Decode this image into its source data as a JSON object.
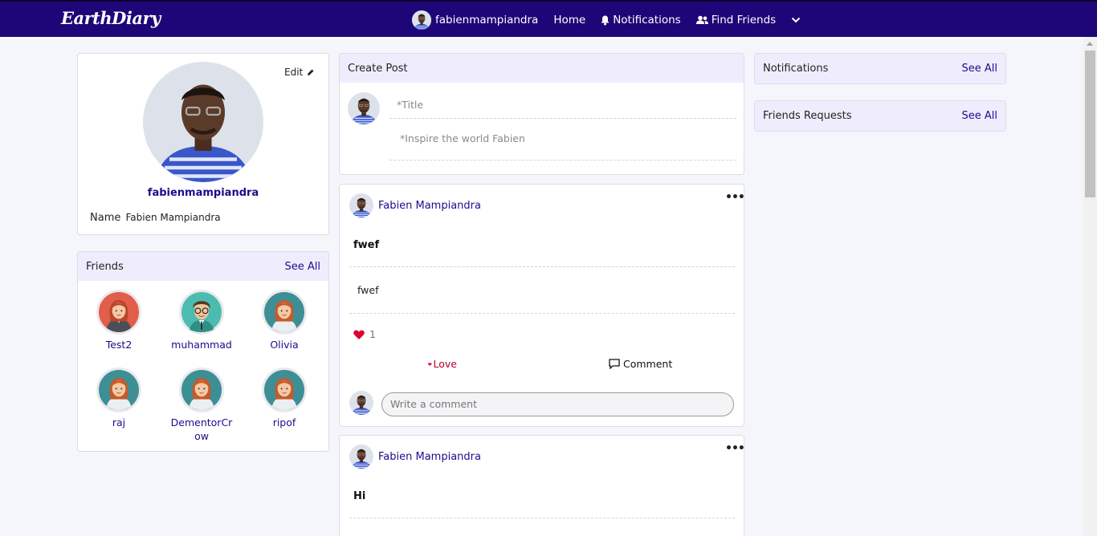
{
  "nav": {
    "logo": "EarthDiary",
    "username": "fabienmampiandra",
    "home": "Home",
    "notifications": "Notifications",
    "find_friends": "Find Friends",
    "icons": [
      "bell-icon",
      "users-icon",
      "chevron-down-icon"
    ]
  },
  "profile": {
    "edit_label": "Edit",
    "username": "fabienmampiandra",
    "name_label": "Name",
    "name_value": "Fabien Mampiandra"
  },
  "friends": {
    "title": "Friends",
    "see_all": "See All",
    "items": [
      {
        "name": "Test2"
      },
      {
        "name": "muhammad"
      },
      {
        "name": "Olivia"
      },
      {
        "name": "raj"
      },
      {
        "name": "DementorCrow"
      },
      {
        "name": "ripof"
      }
    ]
  },
  "create_post": {
    "title": "Create Post",
    "title_placeholder": "*Title",
    "body_placeholder": "*Inspire the world Fabien"
  },
  "posts": [
    {
      "author": "Fabien Mampiandra",
      "title": "fwef",
      "body": "fwef",
      "likes": "1",
      "love_label": "Love",
      "comment_label": "Comment",
      "comment_placeholder": "Write a comment"
    },
    {
      "author": "Fabien Mampiandra",
      "title": "Hi"
    }
  ],
  "notifications_panel": {
    "title": "Notifications",
    "see_all": "See All"
  },
  "friend_requests_panel": {
    "title": "Friends Requests",
    "see_all": "See All"
  },
  "colors": {
    "navbar": "#1e0678",
    "accent": "#1a0d8c",
    "love": "#e0002e",
    "header_bg": "#efedfd"
  }
}
